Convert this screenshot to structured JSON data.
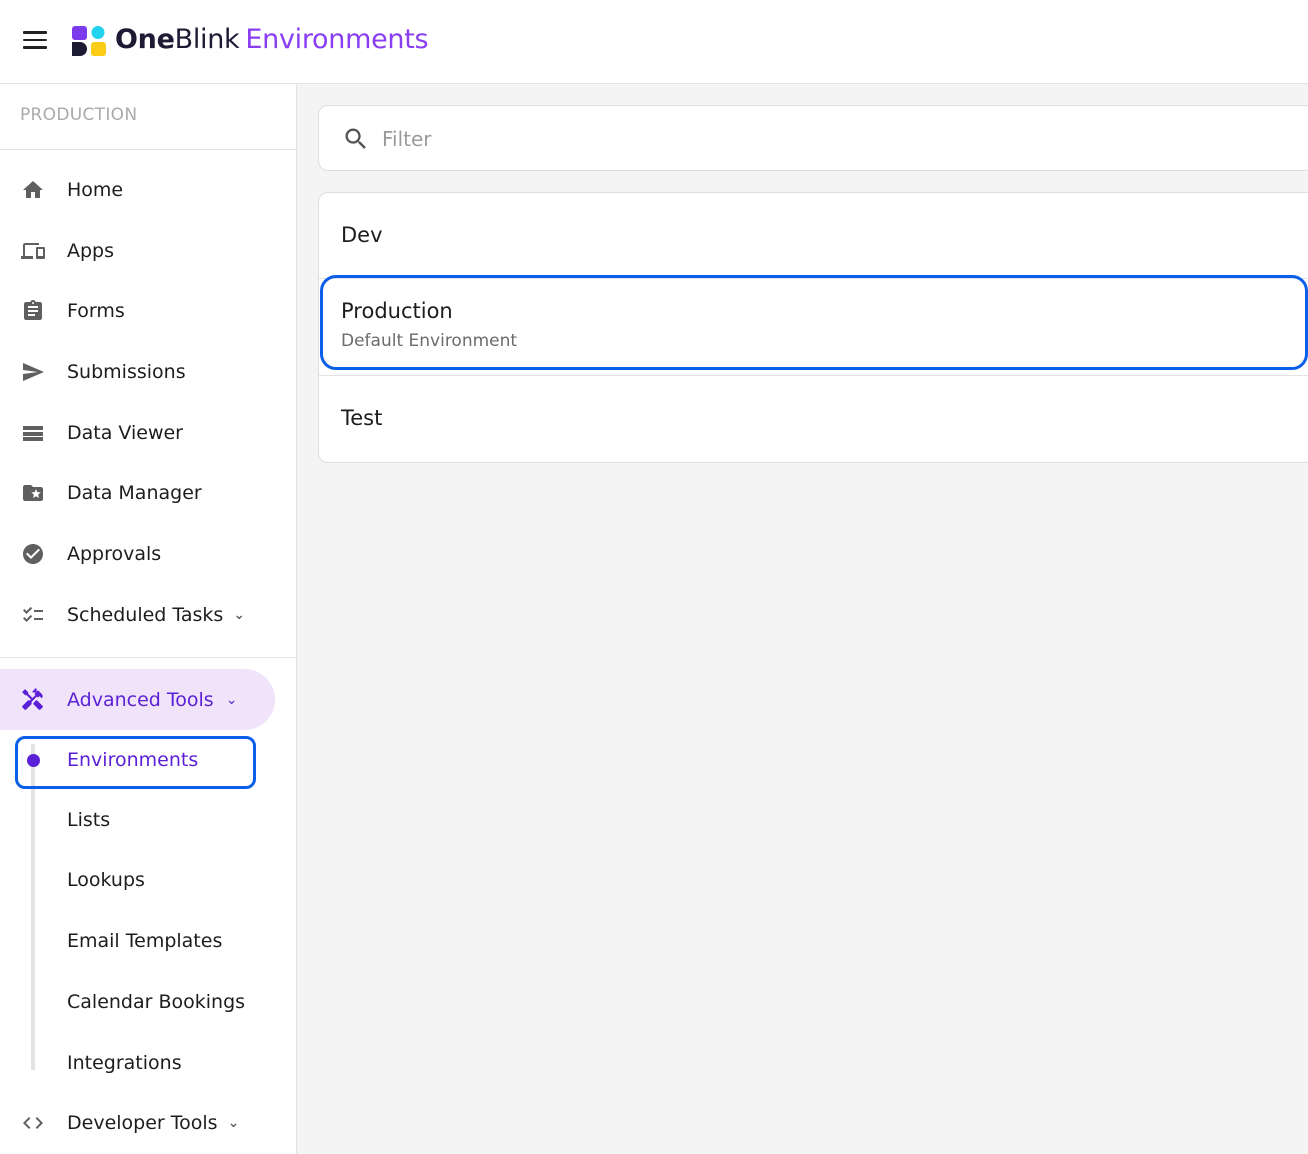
{
  "header": {
    "brand_one": "One",
    "brand_blink": "Blink",
    "brand_section": "Environments",
    "accent_color": "#8a3ef2",
    "logo_colors": [
      "#7c3aed",
      "#22d3ee",
      "#1c1b33",
      "#facc15"
    ]
  },
  "sidebar": {
    "environment_label": "PRODUCTION",
    "items": [
      {
        "label": "Home",
        "icon": "home-icon"
      },
      {
        "label": "Apps",
        "icon": "devices-icon"
      },
      {
        "label": "Forms",
        "icon": "clipboard-icon"
      },
      {
        "label": "Submissions",
        "icon": "send-icon"
      },
      {
        "label": "Data Viewer",
        "icon": "list-icon"
      },
      {
        "label": "Data Manager",
        "icon": "folder-star-icon"
      },
      {
        "label": "Approvals",
        "icon": "check-circle-icon"
      },
      {
        "label": "Scheduled Tasks",
        "icon": "checklist-icon",
        "chevron": "⌄"
      }
    ],
    "advanced": {
      "label": "Advanced Tools",
      "icon": "tools-icon",
      "chevron": "⌄",
      "highlight_color": "#5a1fd6"
    },
    "sub_items": [
      "Environments",
      "Lists",
      "Lookups",
      "Email Templates",
      "Calendar Bookings",
      "Integrations"
    ],
    "developer": {
      "label": "Developer Tools",
      "icon": "code-icon",
      "chevron": "⌄"
    }
  },
  "main": {
    "filter": {
      "placeholder": "Filter",
      "value": ""
    },
    "environments": [
      {
        "name": "Dev",
        "description": ""
      },
      {
        "name": "Production",
        "description": "Default Environment"
      },
      {
        "name": "Test",
        "description": ""
      }
    ]
  }
}
